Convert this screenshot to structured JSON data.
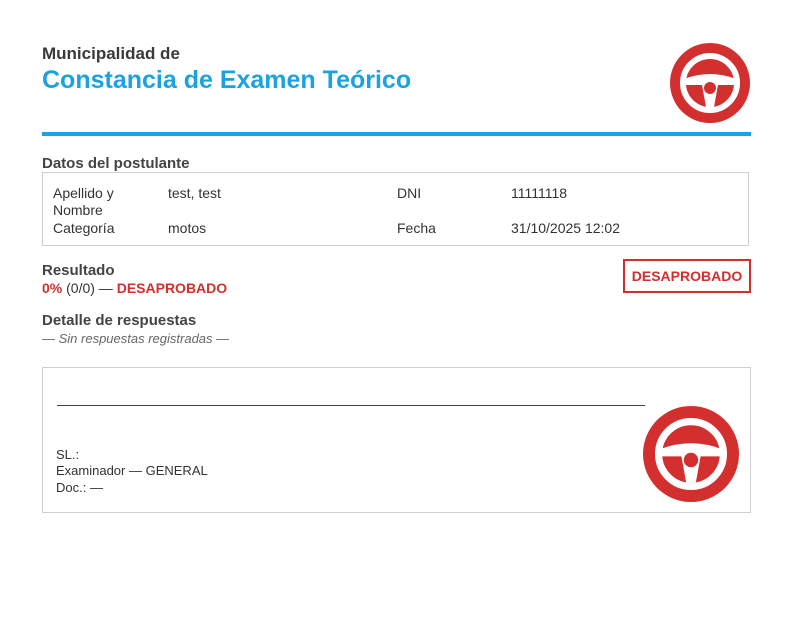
{
  "header": {
    "municipality": "Municipalidad de",
    "title": "Constancia de Examen Teórico"
  },
  "applicant": {
    "section_title": "Datos del postulante",
    "surname_label": "Apellido y Nombre",
    "surname_value": "test, test",
    "dni_label": "DNI",
    "dni_value": "11111118",
    "category_label": "Categoría",
    "category_value": "motos",
    "date_label": "Fecha",
    "date_value": "31/10/2025 12:02"
  },
  "result": {
    "label": "Resultado",
    "percent": "0%",
    "score": "(0/0) —",
    "status": "DESAPROBADO",
    "badge": "DESAPROBADO"
  },
  "details": {
    "title": "Detalle de respuestas",
    "empty_text": "— Sin respuestas registradas —"
  },
  "signature": {
    "name_prefix": "SL.:",
    "examiner": "Examinador — GENERAL",
    "doc": "Doc.: —"
  },
  "colors": {
    "accent_blue": "#1aa3e0",
    "danger_red": "#d32f2f"
  },
  "icons": {
    "logo": "steering-wheel-icon"
  }
}
